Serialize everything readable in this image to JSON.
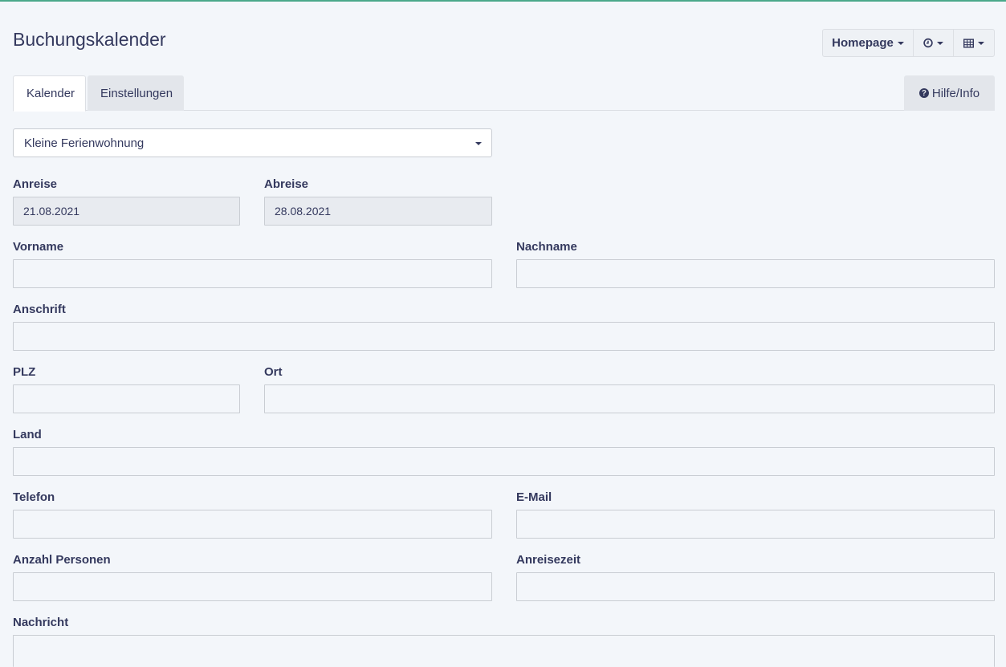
{
  "header": {
    "title": "Buchungskalender",
    "homepage_label": "Homepage",
    "clock_icon": "clock-icon",
    "table_icon": "table-icon"
  },
  "tabs": [
    {
      "label": "Kalender",
      "active": true
    },
    {
      "label": "Einstellungen",
      "active": false
    }
  ],
  "help": {
    "label": "Hilfe/Info",
    "icon": "question-circle-icon"
  },
  "apartment_select": {
    "value": "Kleine Ferienwohnung"
  },
  "form": {
    "anreise": {
      "label": "Anreise",
      "value": "21.08.2021"
    },
    "abreise": {
      "label": "Abreise",
      "value": "28.08.2021"
    },
    "vorname": {
      "label": "Vorname",
      "value": ""
    },
    "nachname": {
      "label": "Nachname",
      "value": ""
    },
    "anschrift": {
      "label": "Anschrift",
      "value": ""
    },
    "plz": {
      "label": "PLZ",
      "value": ""
    },
    "ort": {
      "label": "Ort",
      "value": ""
    },
    "land": {
      "label": "Land",
      "value": ""
    },
    "telefon": {
      "label": "Telefon",
      "value": ""
    },
    "email": {
      "label": "E-Mail",
      "value": ""
    },
    "personen": {
      "label": "Anzahl Personen",
      "value": ""
    },
    "anreisezeit": {
      "label": "Anreisezeit",
      "value": ""
    },
    "nachricht": {
      "label": "Nachricht",
      "value": ""
    }
  },
  "colors": {
    "accent_line": "#4aa88a",
    "background": "#f3f6fa",
    "text": "#34395e"
  }
}
